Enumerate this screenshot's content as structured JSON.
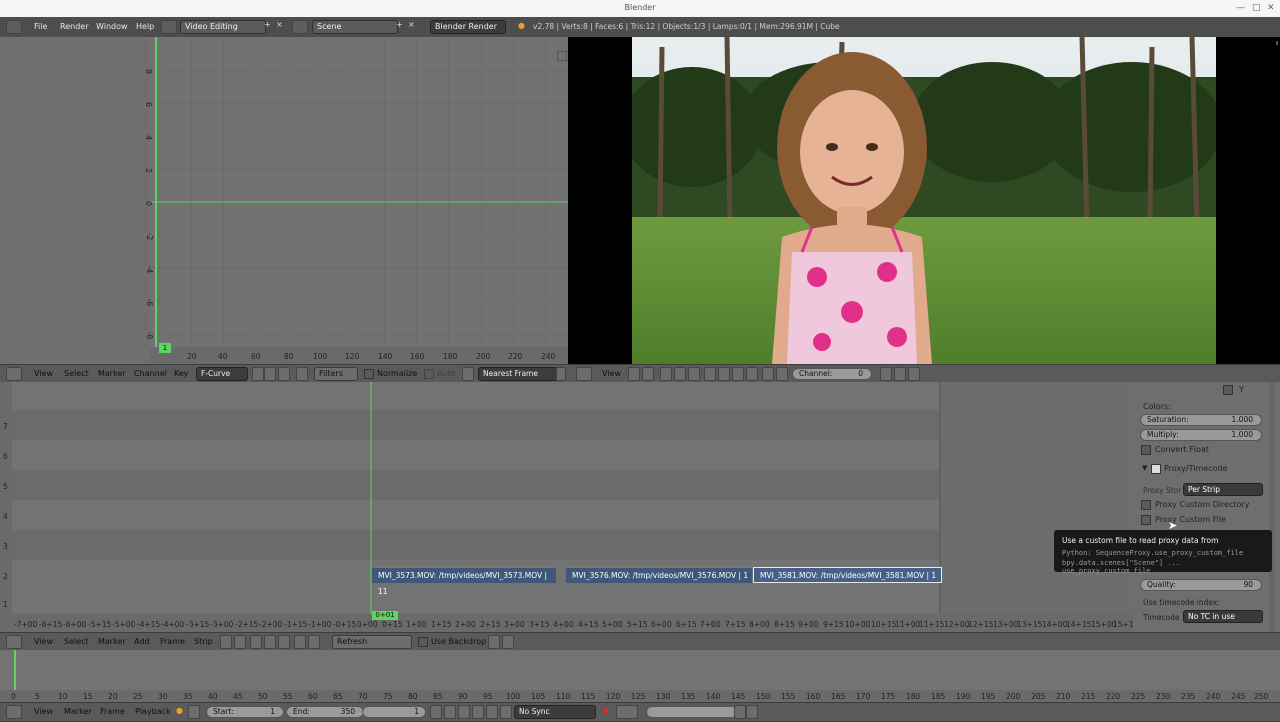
{
  "window": {
    "title": "Blender"
  },
  "infobar": {
    "menus": [
      "File",
      "Render",
      "Window",
      "Help"
    ],
    "screen_layout": "Video Editing",
    "scene": "Scene",
    "render_engine": "Blender Render",
    "stats": "v2.78 | Verts:8 | Faces:6 | Tris:12 | Objects:1/3 | Lamps:0/1 | Mem:296.91M | Cube"
  },
  "graph_editor": {
    "x_ticks": [
      "20",
      "40",
      "60",
      "80",
      "100",
      "120",
      "140",
      "160",
      "180",
      "200",
      "220",
      "240"
    ],
    "y_ticks": [
      "8",
      "6",
      "4",
      "2",
      "0",
      "-2",
      "-4",
      "-6",
      "-8"
    ],
    "frame_marker": "1",
    "header": {
      "menus": [
        "View",
        "Select",
        "Marker",
        "Channel",
        "Key"
      ],
      "mode": "F-Curve",
      "filters": "Filters",
      "normalize": "Normalize",
      "auto": "Auto",
      "snap": "Nearest Frame"
    }
  },
  "preview": {
    "header": {
      "view": "View",
      "channel_label": "Channel:",
      "channel_value": "0"
    }
  },
  "sequencer": {
    "strips": [
      {
        "label": "MVI_3573.MOV: /tmp/videos/MVI_3573.MOV | 11"
      },
      {
        "label": "MVI_3576.MOV: /tmp/videos/MVI_3576.MOV | 1"
      },
      {
        "label": "MVI_3581.MOV: /tmp/videos/MVI_3581.MOV | 1"
      }
    ],
    "current_frame": "0+01",
    "time_ticks": [
      "-7+00",
      "-6+15",
      "-6+00",
      "-5+15",
      "-5+00",
      "-4+15",
      "-4+00",
      "-3+15",
      "-3+00",
      "-2+15",
      "-2+00",
      "-1+15",
      "-1+00",
      "-0+15",
      "0+00",
      "0+15",
      "1+00",
      "1+15",
      "2+00",
      "2+15",
      "3+00",
      "3+15",
      "4+00",
      "4+15",
      "5+00",
      "5+15",
      "6+00",
      "6+15",
      "7+00",
      "7+15",
      "8+00",
      "8+15",
      "9+00",
      "9+15",
      "10+00",
      "10+15",
      "11+00",
      "11+15",
      "12+00",
      "12+15",
      "13+00",
      "13+15",
      "14+00",
      "14+15",
      "15+00",
      "15+1"
    ],
    "channel_ticks": [
      "7",
      "6",
      "5",
      "4",
      "3",
      "2",
      "1"
    ],
    "header": {
      "menus": [
        "View",
        "Select",
        "Marker",
        "Add",
        "Frame",
        "Strip"
      ],
      "refresh": "Refresh Sequencer",
      "backdrop": "Use Backdrop"
    }
  },
  "properties": {
    "y_label": "Y",
    "colors_label": "Colors:",
    "saturation_label": "Saturation:",
    "saturation_value": "1.000",
    "multiply_label": "Multiply:",
    "multiply_value": "1.000",
    "convert_float": "Convert Float",
    "proxy_panel": "Proxy/Timecode",
    "proxy_storage_label": "Proxy Stor",
    "proxy_storage_value": "Per Strip",
    "proxy_custom_dir": "Proxy Custom Directory",
    "proxy_custom_file": "Proxy Custom File",
    "quality_label": "Quality:",
    "quality_value": "90",
    "use_timecode_label": "Use timecode index:",
    "timecode_label": "Timecode",
    "timecode_value": "No TC in use"
  },
  "tooltip": {
    "title": "Use a custom file to read proxy data from",
    "python": "Python: SequenceProxy.use_proxy_custom_file",
    "path": "bpy.data.scenes[\"Scene\"] ... use_proxy_custom_file"
  },
  "timeline": {
    "ticks": [
      "0",
      "5",
      "10",
      "15",
      "20",
      "25",
      "30",
      "35",
      "40",
      "45",
      "50",
      "55",
      "60",
      "65",
      "70",
      "75",
      "80",
      "85",
      "90",
      "95",
      "100",
      "105",
      "110",
      "115",
      "120",
      "125",
      "130",
      "135",
      "140",
      "145",
      "150",
      "155",
      "160",
      "165",
      "170",
      "175",
      "180",
      "185",
      "190",
      "195",
      "200",
      "205",
      "210",
      "215",
      "220",
      "225",
      "230",
      "235",
      "240",
      "245",
      "250"
    ],
    "header": {
      "menus": [
        "View",
        "Marker",
        "Frame",
        "Playback"
      ],
      "start_label": "Start:",
      "start_value": "1",
      "end_label": "End:",
      "end_value": "350",
      "current": "1",
      "sync": "No Sync"
    }
  },
  "colors": {
    "accent_green": "#5fd35f",
    "strip_blue": "#3f5778",
    "ui_dark": "#4d4d4d"
  }
}
